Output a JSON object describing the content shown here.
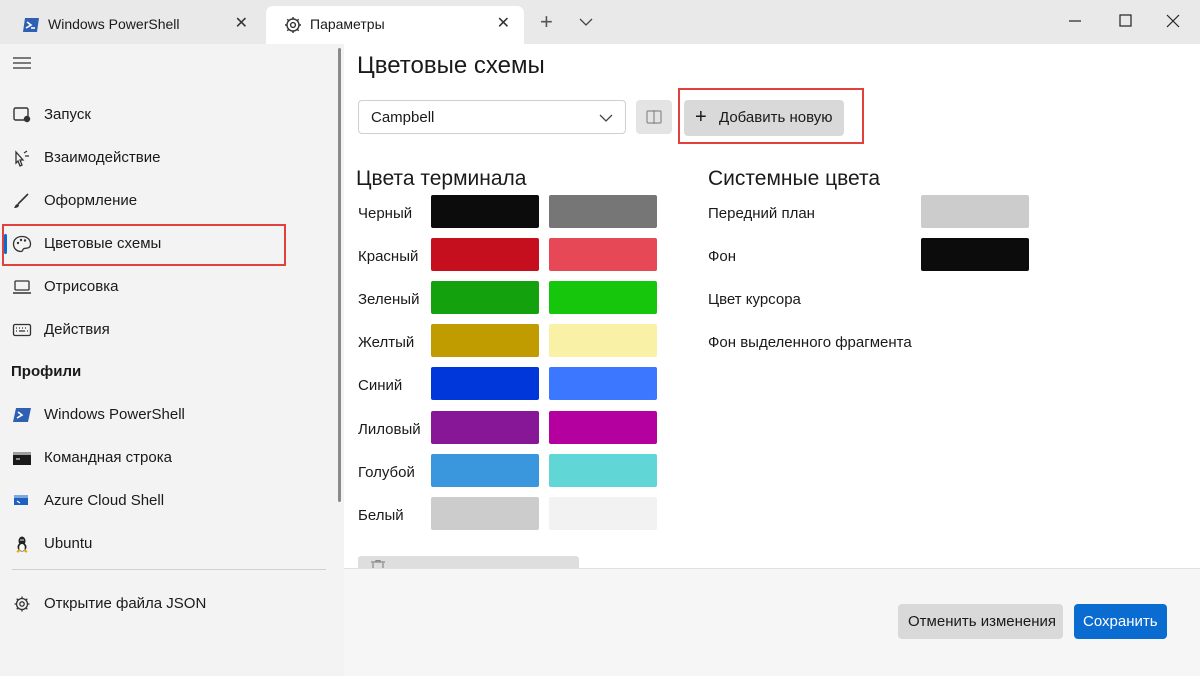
{
  "tabs": [
    {
      "label": "Windows PowerShell",
      "icon": "powershell-icon",
      "close": "✕"
    },
    {
      "label": "Параметры",
      "icon": "gear-icon",
      "close": "✕"
    }
  ],
  "titlebar": {
    "new_tab": "+",
    "min": "minimize-icon",
    "max": "maximize-icon",
    "close": "close-icon"
  },
  "sidebar": {
    "items": [
      {
        "label": "Запуск",
        "icon": "startup-icon"
      },
      {
        "label": "Взаимодействие",
        "icon": "interaction-icon"
      },
      {
        "label": "Оформление",
        "icon": "brush-icon"
      },
      {
        "label": "Цветовые схемы",
        "icon": "palette-icon",
        "selected": true
      },
      {
        "label": "Отрисовка",
        "icon": "monitor-icon"
      },
      {
        "label": "Действия",
        "icon": "keyboard-icon"
      }
    ],
    "profiles_title": "Профили",
    "profiles": [
      {
        "label": "Windows PowerShell",
        "icon": "powershell-icon"
      },
      {
        "label": "Командная строка",
        "icon": "cmd-icon"
      },
      {
        "label": "Azure Cloud Shell",
        "icon": "azure-icon"
      },
      {
        "label": "Ubuntu",
        "icon": "linux-icon"
      }
    ],
    "json_item": {
      "label": "Открытие файла JSON",
      "icon": "gear-icon"
    }
  },
  "main": {
    "title": "Цветовые схемы",
    "scheme": {
      "value": "Campbell"
    },
    "add_new": "Добавить новую",
    "terminal_colors": {
      "title": "Цвета терминала",
      "rows": [
        {
          "label": "Черный",
          "normal": "#0c0c0c",
          "bright": "#767676"
        },
        {
          "label": "Красный",
          "normal": "#c50f1f",
          "bright": "#e74856"
        },
        {
          "label": "Зеленый",
          "normal": "#13a10e",
          "bright": "#16c60c"
        },
        {
          "label": "Желтый",
          "normal": "#c19c00",
          "bright": "#f9f1a5"
        },
        {
          "label": "Синий",
          "normal": "#0037da",
          "bright": "#3b78ff"
        },
        {
          "label": "Лиловый",
          "normal": "#881798",
          "bright": "#b4009e"
        },
        {
          "label": "Голубой",
          "normal": "#3a96dd",
          "bright": "#61d6d6"
        },
        {
          "label": "Белый",
          "normal": "#cccccc",
          "bright": "#f2f2f2"
        }
      ]
    },
    "system_colors": {
      "title": "Системные цвета",
      "rows": [
        {
          "label": "Передний план",
          "color": "#cccccc"
        },
        {
          "label": "Фон",
          "color": "#0c0c0c"
        },
        {
          "label": "Цвет курсора"
        },
        {
          "label": "Фон выделенного фрагмента"
        }
      ]
    },
    "discard": "Отменить изменения",
    "save": "Сохранить"
  },
  "accent_color": "#0a6cd0",
  "highlight_color": "#e0413c"
}
